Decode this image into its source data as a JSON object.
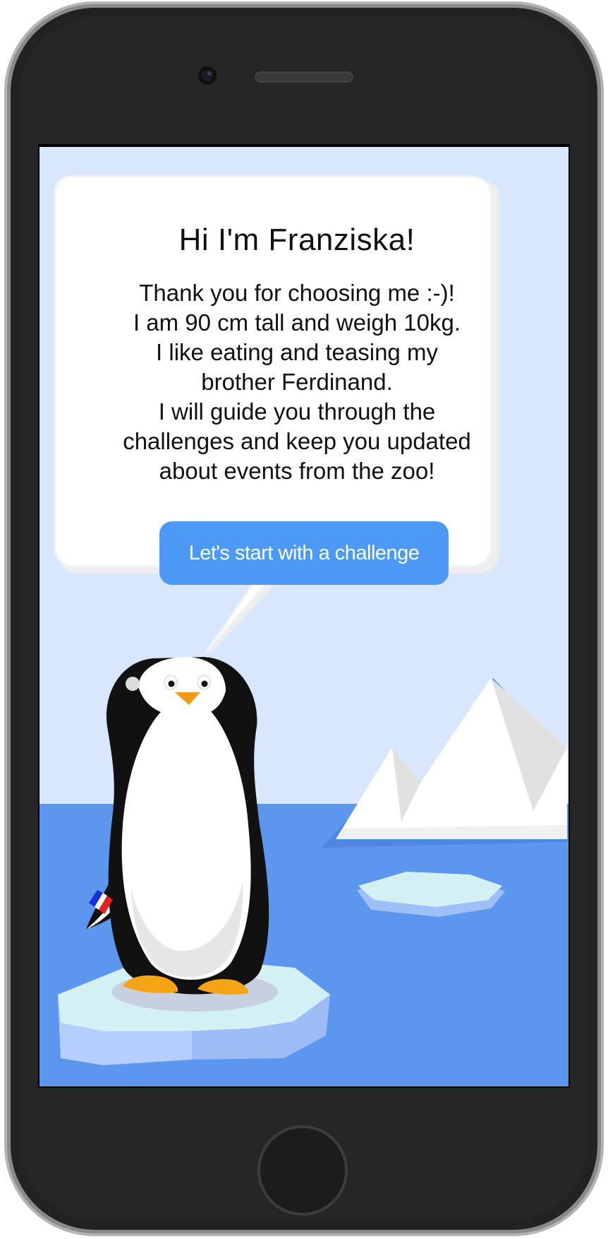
{
  "speech": {
    "title": "Hi I'm Franziska!",
    "body_lines": [
      "Thank you for choosing me :-)!",
      "I am 90 cm tall and weigh 10kg.",
      "I like eating and teasing my",
      "brother Ferdinand.",
      "I will guide you through the",
      "challenges and keep you updated",
      "about events from the zoo!"
    ],
    "cta_label": "Let's start with a challenge"
  },
  "colors": {
    "sky": "#d9e7fd",
    "sea": "#5c96ef",
    "accent_button": "#4d9af4",
    "ice_top": "#d3f1f4",
    "ice_side": "#a7c6fa",
    "phone_body": "#222222"
  },
  "icons": {
    "flag": "flag-icon"
  }
}
